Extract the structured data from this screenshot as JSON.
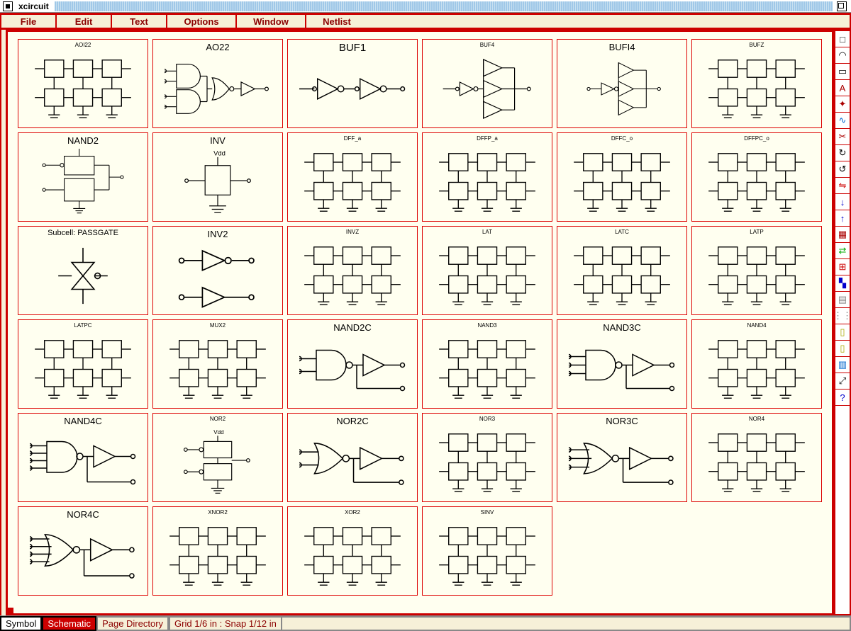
{
  "window": {
    "title": "xcircuit"
  },
  "menu": {
    "items": [
      "File",
      "Edit",
      "Text",
      "Options",
      "Window",
      "Netlist"
    ]
  },
  "library": {
    "cells": [
      {
        "label": "AOI22",
        "size": "tiny",
        "art": "complex"
      },
      {
        "label": "AO22",
        "size": "med",
        "art": "and-buf"
      },
      {
        "label": "BUF1",
        "size": "big",
        "art": "buf1"
      },
      {
        "label": "BUF4",
        "size": "tiny",
        "art": "buf4"
      },
      {
        "label": "BUFI4",
        "size": "med",
        "art": "bufi4"
      },
      {
        "label": "BUFZ",
        "size": "tiny",
        "art": "complex"
      },
      {
        "label": "NAND2",
        "size": "med",
        "art": "nand2t"
      },
      {
        "label": "INV",
        "size": "med",
        "art": "inv"
      },
      {
        "label": "DFF_a",
        "size": "tiny",
        "art": "complex"
      },
      {
        "label": "DFFP_a",
        "size": "tiny",
        "art": "complex"
      },
      {
        "label": "DFFC_o",
        "size": "tiny",
        "art": "complex"
      },
      {
        "label": "DFFPC_o",
        "size": "tiny",
        "art": "complex"
      },
      {
        "label": "Subcell: PASSGATE",
        "size": "",
        "art": "passgate"
      },
      {
        "label": "INV2",
        "size": "med",
        "art": "inv2"
      },
      {
        "label": "INVZ",
        "size": "tiny",
        "art": "complex"
      },
      {
        "label": "LAT",
        "size": "tiny",
        "art": "complex"
      },
      {
        "label": "LATC",
        "size": "tiny",
        "art": "complex"
      },
      {
        "label": "LATP",
        "size": "tiny",
        "art": "complex"
      },
      {
        "label": "LATPC",
        "size": "tiny",
        "art": "complex"
      },
      {
        "label": "MUX2",
        "size": "tiny",
        "art": "complex"
      },
      {
        "label": "NAND2C",
        "size": "med",
        "art": "nand-buf"
      },
      {
        "label": "NAND3",
        "size": "tiny",
        "art": "complex"
      },
      {
        "label": "NAND3C",
        "size": "med",
        "art": "nand3-buf"
      },
      {
        "label": "NAND4",
        "size": "tiny",
        "art": "complex"
      },
      {
        "label": "NAND4C",
        "size": "med",
        "art": "nand4-buf"
      },
      {
        "label": "NOR2",
        "size": "tiny",
        "art": "nor2t"
      },
      {
        "label": "NOR2C",
        "size": "med",
        "art": "nor-buf"
      },
      {
        "label": "NOR3",
        "size": "tiny",
        "art": "complex"
      },
      {
        "label": "NOR3C",
        "size": "med",
        "art": "nor3-buf"
      },
      {
        "label": "NOR4",
        "size": "tiny",
        "art": "complex"
      },
      {
        "label": "NOR4C",
        "size": "med",
        "art": "nor4-buf"
      },
      {
        "label": "XNOR2",
        "size": "tiny",
        "art": "complex"
      },
      {
        "label": "XOR2",
        "size": "tiny",
        "art": "complex"
      },
      {
        "label": "SINV",
        "size": "tiny",
        "art": "complex"
      }
    ]
  },
  "tools": {
    "items": [
      {
        "name": "wire-tool",
        "glyph": "□",
        "color": "#000"
      },
      {
        "name": "arc-tool",
        "glyph": "◠",
        "color": "#000"
      },
      {
        "name": "box-tool",
        "glyph": "▭",
        "color": "#000"
      },
      {
        "name": "text-tool",
        "glyph": "A",
        "color": "#a00"
      },
      {
        "name": "star-tool",
        "glyph": "✦",
        "color": "#a00"
      },
      {
        "name": "spline-tool",
        "glyph": "∿",
        "color": "#06c"
      },
      {
        "name": "cut-tool",
        "glyph": "✂",
        "color": "#a00"
      },
      {
        "name": "rotate-cw-tool",
        "glyph": "↻",
        "color": "#000"
      },
      {
        "name": "rotate-ccw-tool",
        "glyph": "↺",
        "color": "#000"
      },
      {
        "name": "flip-h-tool",
        "glyph": "⇋",
        "color": "#c00"
      },
      {
        "name": "arrow-down-tool",
        "glyph": "↓",
        "color": "#00c"
      },
      {
        "name": "arrow-up-tool",
        "glyph": "↑",
        "color": "#00c"
      },
      {
        "name": "library-tool",
        "glyph": "▦",
        "color": "#a00"
      },
      {
        "name": "mirror-tool",
        "glyph": "⇄",
        "color": "#0a0"
      },
      {
        "name": "group-tool",
        "glyph": "⊞",
        "color": "#c00"
      },
      {
        "name": "palette-tool",
        "glyph": "▚",
        "color": "#00c"
      },
      {
        "name": "grid-tool",
        "glyph": "▤",
        "color": "#888"
      },
      {
        "name": "dots-tool",
        "glyph": "⋮⋮",
        "color": "#888"
      },
      {
        "name": "page1-tool",
        "glyph": "▯",
        "color": "#aa0"
      },
      {
        "name": "page2-tool",
        "glyph": "▯",
        "color": "#aa0"
      },
      {
        "name": "book-tool",
        "glyph": "▥",
        "color": "#06c"
      },
      {
        "name": "zoom-tool",
        "glyph": "⤢",
        "color": "#000"
      },
      {
        "name": "help-tool",
        "glyph": "?",
        "color": "#00c"
      }
    ]
  },
  "status": {
    "symbol": "Symbol",
    "schematic": "Schematic",
    "page_directory": "Page Directory",
    "grid": "Grid 1/6 in : Snap 1/12 in"
  }
}
